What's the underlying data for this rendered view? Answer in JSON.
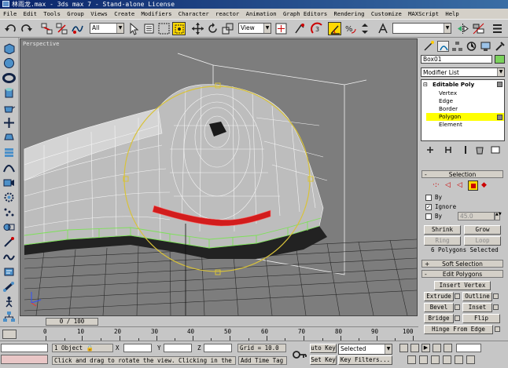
{
  "title": "林雨龙.max - 3ds max 7 - Stand-alone License",
  "menu": [
    "File",
    "Edit",
    "Tools",
    "Group",
    "Views",
    "Create",
    "Modifiers",
    "Character",
    "reactor",
    "Animation",
    "Graph Editors",
    "Rendering",
    "Customize",
    "MAXScript",
    "Help"
  ],
  "toolbar": {
    "selection_filter": "All",
    "ref_coord": "View",
    "named_selection": ""
  },
  "viewport": {
    "label": "Perspective"
  },
  "command_panel": {
    "object_name": "Box01",
    "object_color": "#7bd25c",
    "modifier_list": "Modifier List",
    "stack": {
      "root": "Editable Poly",
      "items": [
        "Vertex",
        "Edge",
        "Border",
        "Polygon",
        "Element"
      ],
      "selected": "Polygon"
    },
    "selection": {
      "title": "Selection",
      "by_vertex": "By",
      "ignore_backfacing": "Ignore",
      "ignore_checked": true,
      "by_angle": "By",
      "angle_value": "45.0",
      "shrink": "Shrink",
      "grow": "Grow",
      "ring": "Ring",
      "loop": "Loop",
      "status": "6 Polygons Selected"
    },
    "soft_selection": "Soft Selection",
    "edit_polygons": {
      "title": "Edit Polygons",
      "insert_vertex": "Insert Vertex",
      "extrude": "Extrude",
      "outline": "Outline",
      "bevel": "Bevel",
      "inset": "Inset",
      "bridge": "Bridge",
      "flip": "Flip",
      "hinge": "Hinge From Edge"
    }
  },
  "timeline": {
    "slider": "0 / 100",
    "ticks": [
      "0",
      "10",
      "20",
      "30",
      "40",
      "50",
      "60",
      "70",
      "80",
      "90",
      "100"
    ]
  },
  "status": {
    "objects": "1 Object",
    "x_label": "X",
    "y_label": "Y",
    "z_label": "Z",
    "grid": "Grid = 10.0",
    "prompt": "Click and drag to rotate the view.  Clicking in the",
    "add_time_tag": "Add Time Tag",
    "auto_key": "uto Key",
    "set_key": "Set Key",
    "key_mode": "Selected",
    "key_filters": "Key Filters..."
  }
}
